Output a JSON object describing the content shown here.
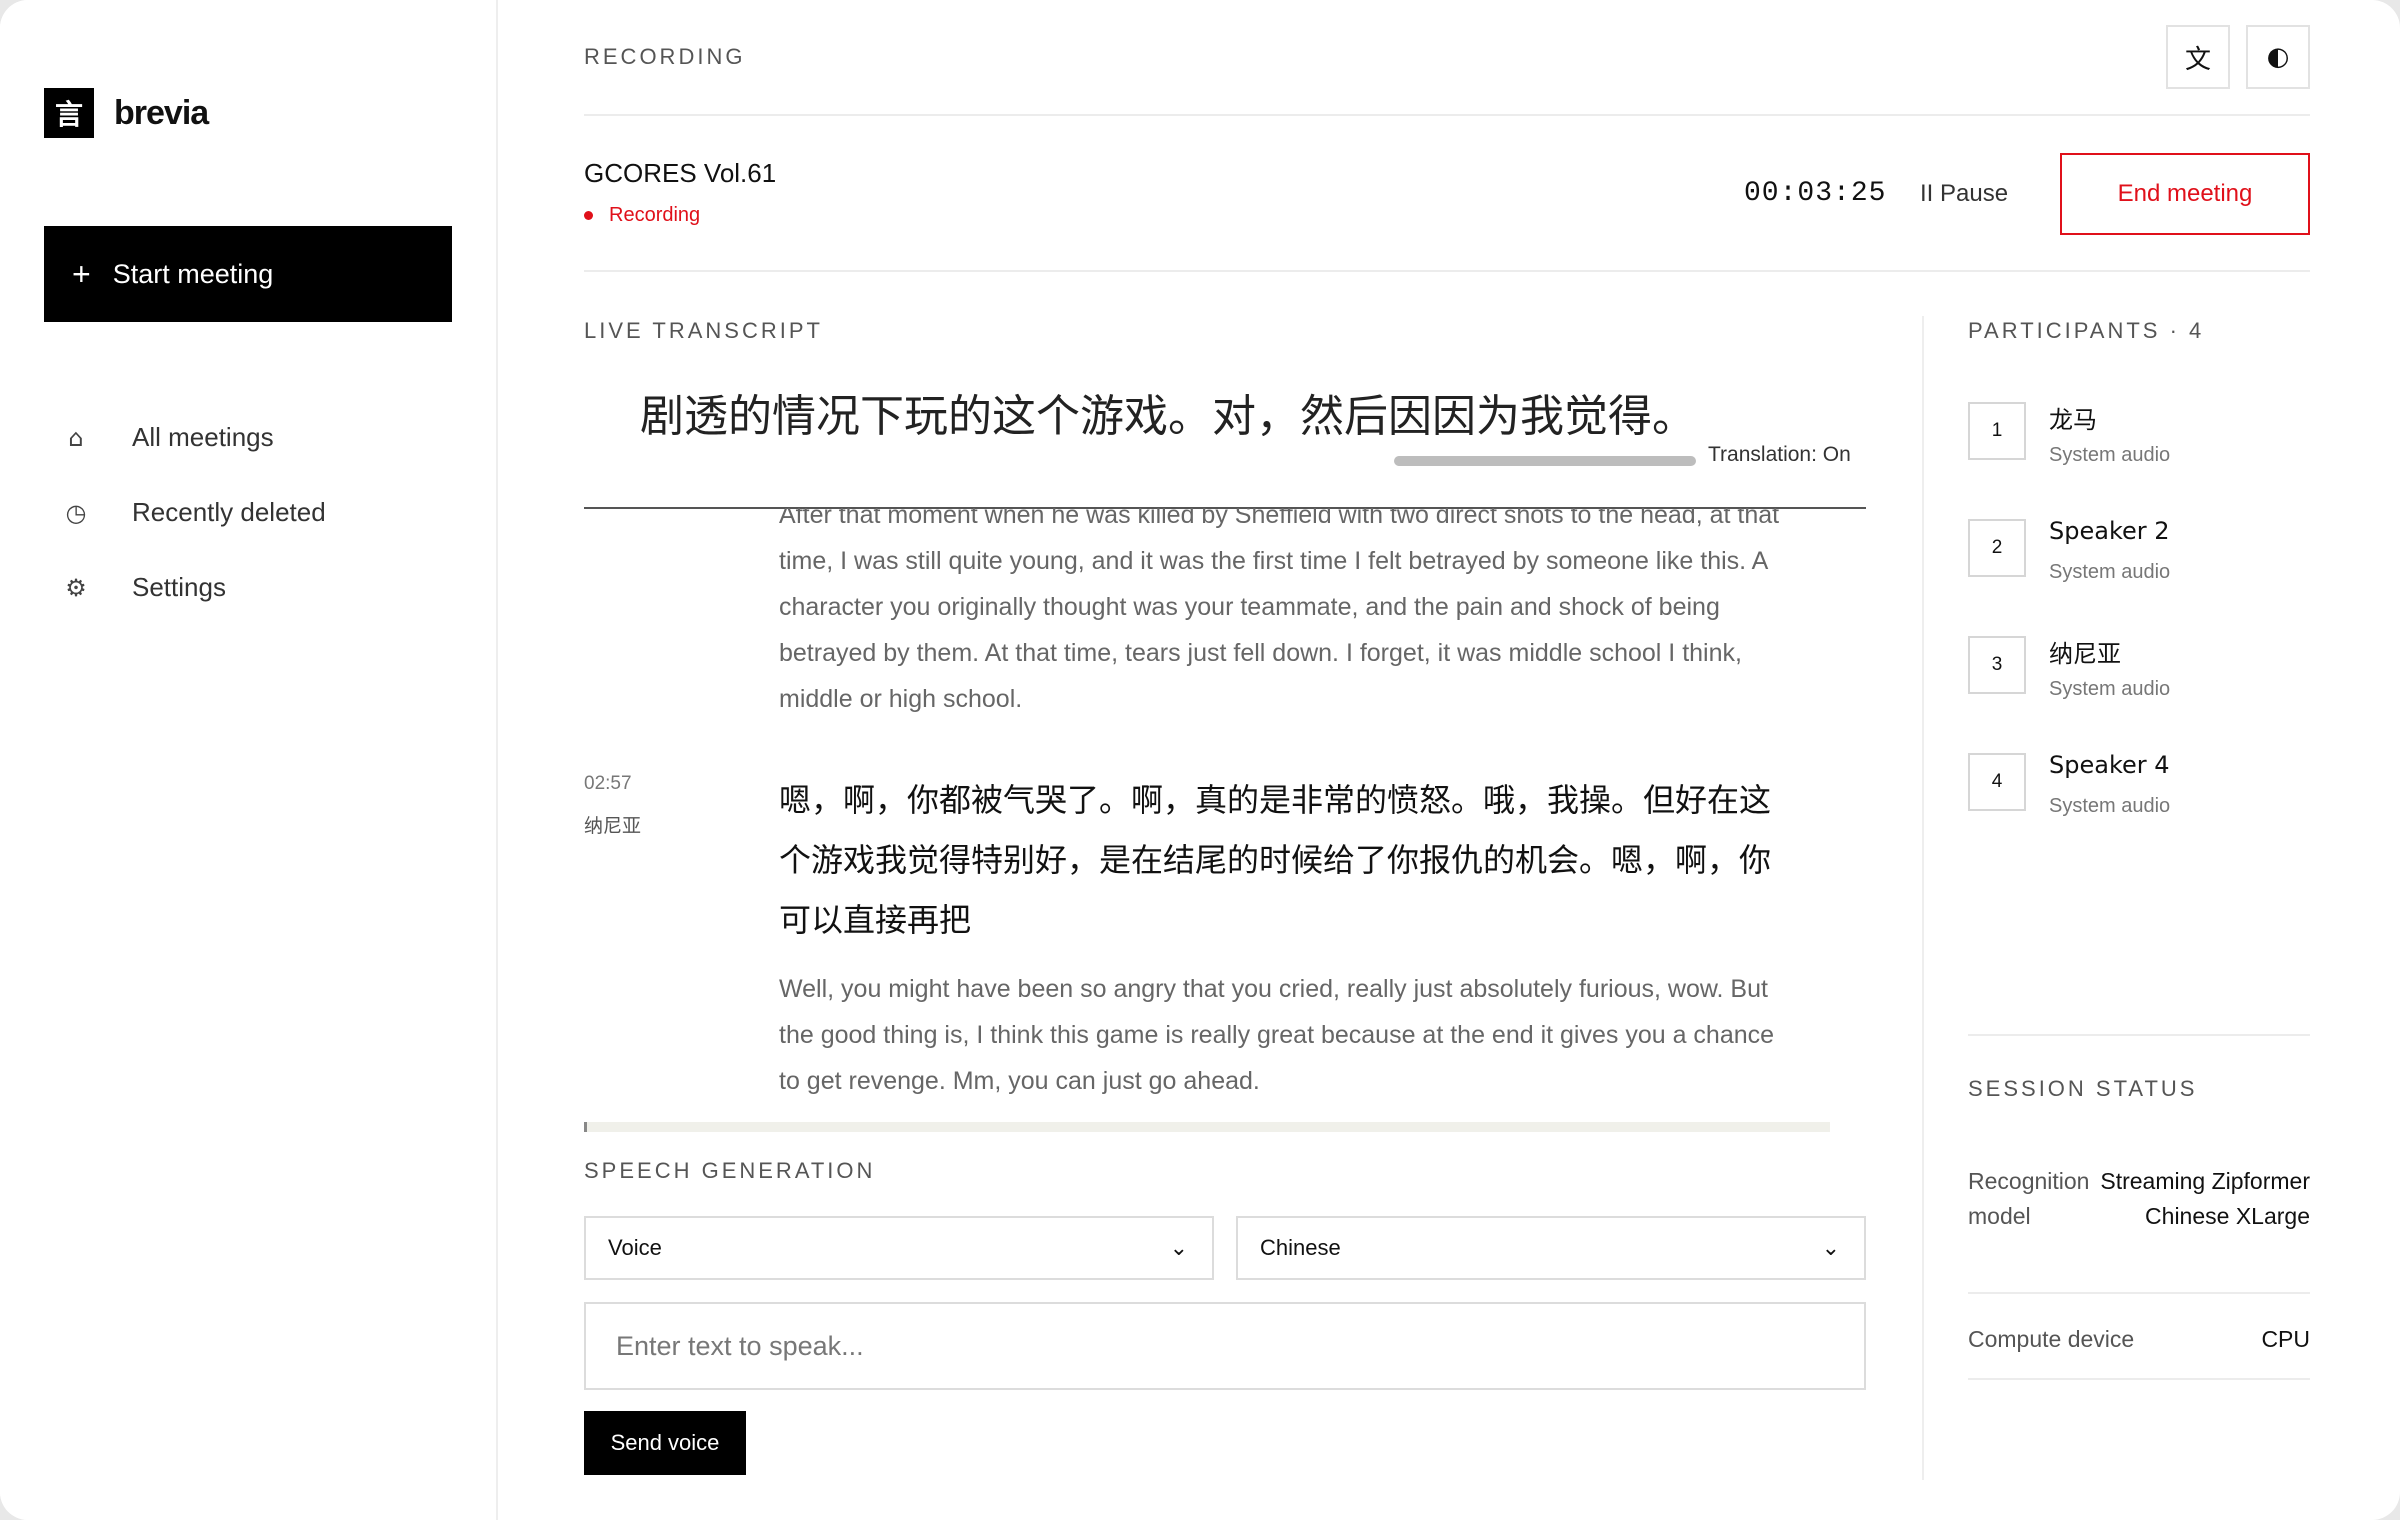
{
  "app": {
    "logo_mark": "言",
    "name": "brevia"
  },
  "sidebar": {
    "start_label": "Start meeting",
    "items": [
      {
        "label": "All meetings",
        "icon": "⌂"
      },
      {
        "label": "Recently deleted",
        "icon": "◷"
      },
      {
        "label": "Settings",
        "icon": "⚙"
      }
    ]
  },
  "topbar": {
    "label": "RECORDING",
    "translate_icon": "文",
    "theme_icon": "◐"
  },
  "meeting": {
    "title": "GCORES Vol.61",
    "status": "Recording",
    "timer": "00:03:25",
    "pause_label": "II Pause",
    "end_label": "End meeting"
  },
  "transcript": {
    "label": "LIVE TRANSCRIPT",
    "live_text": "剧透的情况下玩的这个游戏。对，然后因因为我觉得。",
    "translation_toggle": "Translation: On",
    "entries": [
      {
        "time": "",
        "speaker": "",
        "original": "",
        "translation": "After that moment when he was killed by Sheffield with two direct shots to the head, at that time, I was still quite young, and it was the first time I felt betrayed by someone like this. A character you originally thought was your teammate, and the pain and shock of being betrayed by them. At that time, tears just fell down. I forget, it was middle school I think, middle or high school."
      },
      {
        "time": "02:57",
        "speaker": "纳尼亚",
        "original": "嗯，啊，你都被气哭了。啊，真的是非常的愤怒。哦，我操。但好在这个游戏我觉得特别好，是在结尾的时候给了你报仇的机会。嗯，啊，你可以直接再把",
        "translation": "Well, you might have been so angry that you cried, really just absolutely furious, wow. But the good thing is, I think this game is really great because at the end it gives you a chance to get revenge. Mm, you can just go ahead."
      }
    ]
  },
  "speech": {
    "label": "SPEECH GENERATION",
    "voice": "Voice",
    "language": "Chinese",
    "placeholder": "Enter text to speak...",
    "send_label": "Send voice"
  },
  "participants": {
    "label": "PARTICIPANTS · 4",
    "items": [
      {
        "n": "1",
        "name": "龙马",
        "source": "System audio"
      },
      {
        "n": "2",
        "name": "Speaker 2",
        "source": "System audio"
      },
      {
        "n": "3",
        "name": "纳尼亚",
        "source": "System audio"
      },
      {
        "n": "4",
        "name": "Speaker 4",
        "source": "System audio"
      }
    ]
  },
  "session": {
    "label": "SESSION STATUS",
    "rows": [
      {
        "key": "Recognition model",
        "value": "Streaming Zipformer Chinese XLarge"
      },
      {
        "key": "Compute device",
        "value": "CPU"
      }
    ]
  },
  "colors": {
    "accent": "#000000",
    "recording": "#e0101a"
  }
}
